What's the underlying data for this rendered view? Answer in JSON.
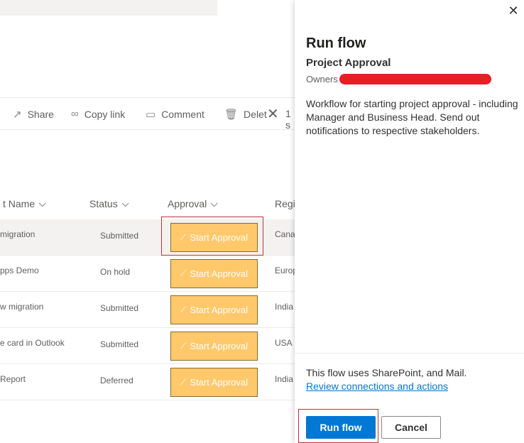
{
  "list": {
    "commands": {
      "share": "Share",
      "copy_link": "Copy link",
      "comment": "Comment",
      "delete": "Delet",
      "selected": "1 s"
    },
    "headers": {
      "name": "t Name",
      "status": "Status",
      "approval": "Approval",
      "region": "Regi"
    },
    "rows": [
      {
        "name": "migration",
        "status": "Submitted",
        "approval": "Start Approval",
        "region": "Cana"
      },
      {
        "name": "pps Demo",
        "status": "On hold",
        "approval": "Start Approval",
        "region": "Europ"
      },
      {
        "name": "w migration",
        "status": "Submitted",
        "approval": "Start Approval",
        "region": "India"
      },
      {
        "name": "e card in Outlook",
        "status": "Submitted",
        "approval": "Start Approval",
        "region": "USA"
      },
      {
        "name": "Report",
        "status": "Deferred",
        "approval": "Start Approval",
        "region": "India"
      }
    ]
  },
  "panel": {
    "title": "Run flow",
    "flow_name": "Project Approval",
    "owner_label": "Owners",
    "description": "Workflow for starting project approval - including Manager and Business Head. Send out notifications to respective stakeholders.",
    "uses_text": "This flow uses SharePoint, and Mail.",
    "review_link": "Review connections and actions",
    "run_button": "Run flow",
    "cancel_button": "Cancel"
  },
  "colors": {
    "primary": "#0078d4",
    "approval_button": "#ffc86b",
    "highlight_outline": "#c4313a",
    "redaction": "#e81e25"
  },
  "icons": [
    "share-icon",
    "link-icon",
    "comment-icon",
    "trash-icon",
    "close-icon",
    "flow-icon"
  ]
}
